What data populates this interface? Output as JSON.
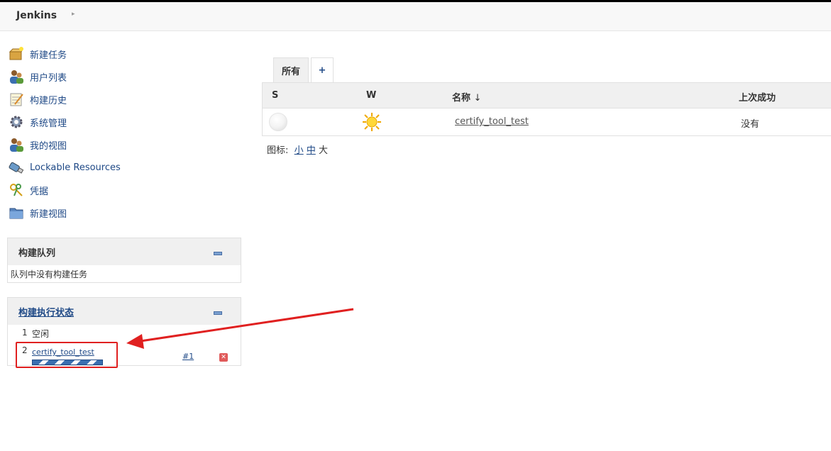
{
  "header": {
    "brand": "Jenkins",
    "breadcrumb_arrow": "▸"
  },
  "sidebar": {
    "tasks": [
      {
        "label": "新建任务",
        "icon": "new-package-icon"
      },
      {
        "label": "用户列表",
        "icon": "people-icon"
      },
      {
        "label": "构建历史",
        "icon": "notepad-icon"
      },
      {
        "label": "系统管理",
        "icon": "gear-icon"
      },
      {
        "label": "我的视图",
        "icon": "user-icon"
      },
      {
        "label": "Lockable Resources",
        "icon": "usb-key-icon"
      },
      {
        "label": "凭据",
        "icon": "keys-icon"
      },
      {
        "label": "新建视图",
        "icon": "folder-icon"
      }
    ]
  },
  "queue": {
    "title": "构建队列",
    "empty_text": "队列中没有构建任务"
  },
  "executors": {
    "title": "构建执行状态",
    "rows": [
      {
        "num": "1",
        "status": "空闲"
      },
      {
        "num": "2",
        "job": "certify_tool_test",
        "build": "#1"
      }
    ]
  },
  "main": {
    "tabs": [
      {
        "label": "所有",
        "active": true
      },
      {
        "label": "+"
      }
    ],
    "columns": {
      "s": "S",
      "w": "W",
      "name": "名称",
      "name_sort": "↓",
      "last_success": "上次成功"
    },
    "jobs": [
      {
        "name": "certify_tool_test",
        "last_success": "没有"
      }
    ],
    "icon_size": {
      "label": "图标:",
      "small": "小",
      "medium": "中",
      "large": "大"
    }
  },
  "colors": {
    "link": "#204a87",
    "annotation": "#e02020"
  }
}
